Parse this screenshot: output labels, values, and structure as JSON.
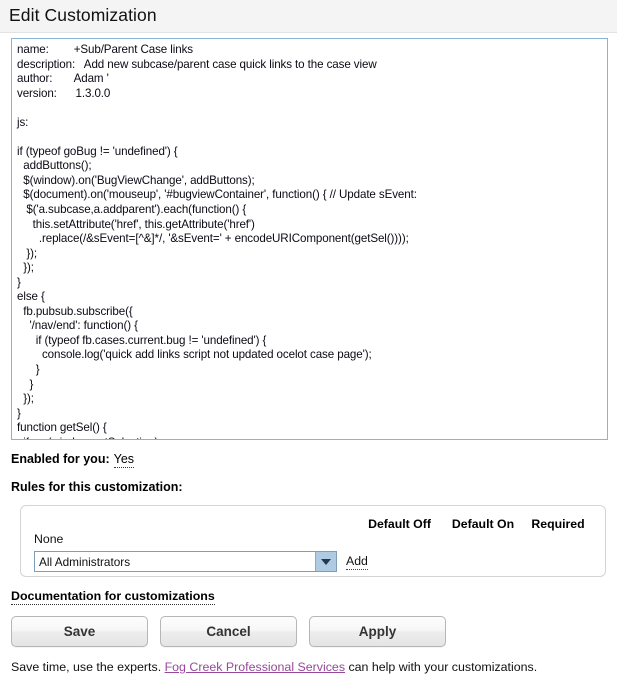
{
  "header": {
    "title": "Edit Customization"
  },
  "code_editor": {
    "value": "name:        +Sub/Parent Case links\ndescription:   Add new subcase/parent case quick links to the case view\nauthor:       Adam '\nversion:      1.3.0.0\n\njs:\n\nif (typeof goBug != 'undefined') {\n  addButtons();\n  $(window).on('BugViewChange', addButtons);\n  $(document).on('mouseup', '#bugviewContainer', function() { // Update sEvent:\n   $('a.subcase,a.addparent').each(function() {\n     this.setAttribute('href', this.getAttribute('href')\n       .replace(/&sEvent=[^&]*/, '&sEvent=' + encodeURIComponent(getSel())));\n   });\n  });\n}\nelse {\n  fb.pubsub.subscribe({\n    '/nav/end': function() {\n      if (typeof fb.cases.current.bug != 'undefined') {\n        console.log('quick add links script not updated ocelot case page');\n      }\n    }\n  });\n}\nfunction getSel() {\n  if      (window.getSelection)\n    return   window.getSelection().toString();\n  else if (document.getSelection)\n    return document.getSelection().toString();"
  },
  "enabled": {
    "label": "Enabled for you:",
    "value": "Yes"
  },
  "rules": {
    "section_label": "Rules for this customization:",
    "columns": [
      "Default Off",
      "Default On",
      "Required"
    ],
    "empty_text": "None",
    "select_value": "All Administrators",
    "add_label": "Add"
  },
  "documentation": {
    "link_label": "Documentation for customizations"
  },
  "buttons": {
    "save": "Save",
    "cancel": "Cancel",
    "apply": "Apply"
  },
  "footer": {
    "prefix": "Save time, use the experts. ",
    "link": "Fog Creek Professional Services",
    "suffix": " can help with your customizations."
  },
  "colors": {
    "header_bg": "#f4f4f4",
    "textarea_border": "#8ab4d4",
    "select_button": "#aecbe3",
    "footer_link": "#96489b"
  }
}
